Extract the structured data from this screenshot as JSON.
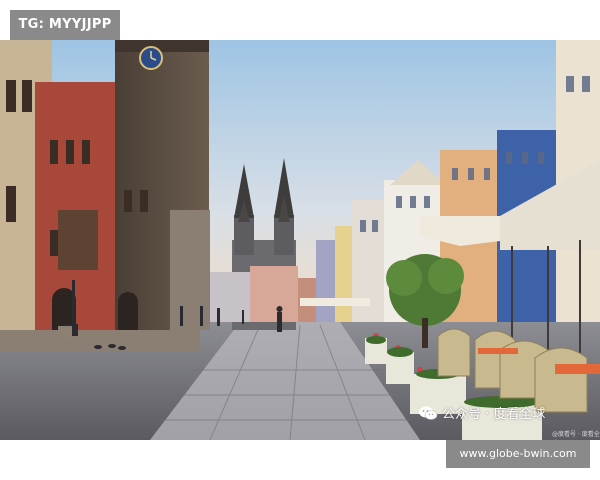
{
  "badge_top": {
    "text": "TG: MYYJJPP"
  },
  "watermark": {
    "text": "公众号 · 度看全球",
    "icon": "wechat-icon",
    "small_text": "@度看号 · 度看全球"
  },
  "badge_bottom": {
    "text": "www.globe-bwin.com"
  },
  "palette": {
    "badge_bg": "#8a8a8a",
    "sky_top": "#9ec4e4",
    "sky_bottom": "#f3dcc2"
  }
}
